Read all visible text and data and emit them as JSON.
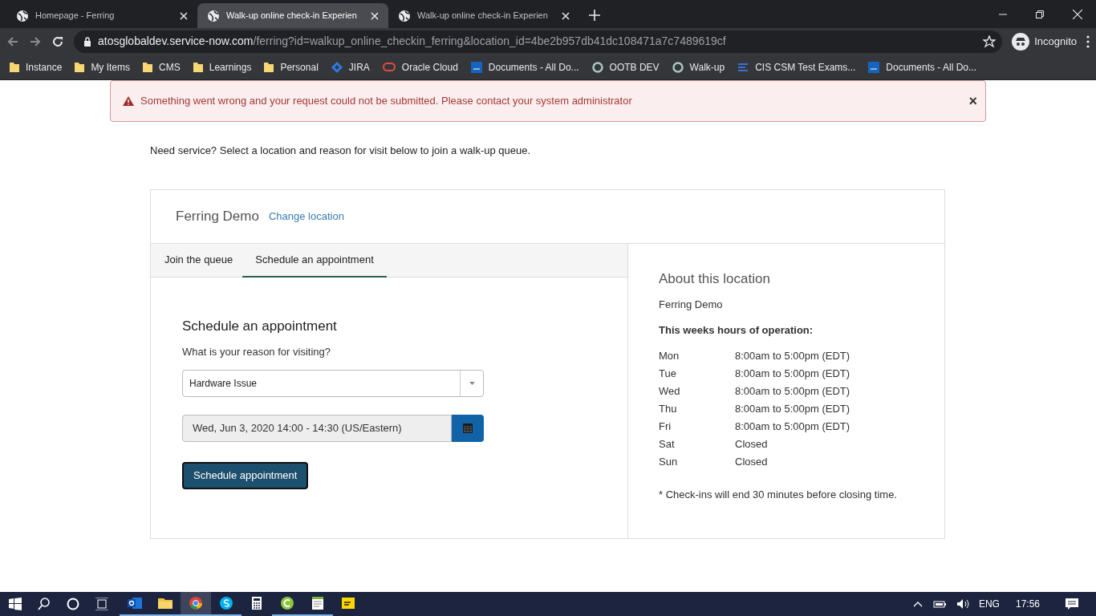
{
  "browser_tabs": [
    {
      "title": "Homepage - Ferring",
      "selected": false
    },
    {
      "title": "Walk-up online check-in Experien",
      "selected": true
    },
    {
      "title": "Walk-up online check-in Experien",
      "selected": false
    }
  ],
  "address_bar": {
    "host": "atosglobaldev.service-now.com",
    "path": "/ferring?id=walkup_online_checkin_ferring&location_id=4be2b957db41dc108471a7c7489619cf",
    "profile": "Incognito"
  },
  "bookmarks": [
    {
      "kind": "folder",
      "label": "Instance"
    },
    {
      "kind": "folder",
      "label": "My Items"
    },
    {
      "kind": "folder",
      "label": "CMS"
    },
    {
      "kind": "folder",
      "label": "Learnings"
    },
    {
      "kind": "folder",
      "label": "Personal"
    },
    {
      "kind": "diamond",
      "label": "JIRA"
    },
    {
      "kind": "oracle",
      "label": "Oracle Cloud"
    },
    {
      "kind": "atos",
      "label": "Documents - All Do..."
    },
    {
      "kind": "ring",
      "label": "OOTB DEV"
    },
    {
      "kind": "ring",
      "label": "Walk-up"
    },
    {
      "kind": "bars",
      "label": "CIS CSM Test Exams..."
    },
    {
      "kind": "atos",
      "label": "Documents - All Do..."
    }
  ],
  "alert": {
    "message": "Something went wrong and your request could not be submitted. Please contact your system administrator",
    "close": "×"
  },
  "subtitle": "Need service? Select a location and reason for visit below to join a walk-up queue.",
  "location": {
    "name": "Ferring Demo",
    "change_link": "Change location"
  },
  "tabs": [
    {
      "label": "Join the queue",
      "selected": false
    },
    {
      "label": "Schedule an appointment",
      "selected": true
    }
  ],
  "form": {
    "title": "Schedule an appointment",
    "question": "What is your reason for visiting?",
    "reason": "Hardware Issue",
    "datetime": "Wed, Jun 3, 2020 14:00 - 14:30 (US/Eastern)",
    "submit": "Schedule appointment"
  },
  "about": {
    "title": "About this location",
    "name": "Ferring Demo",
    "hours_title": "This weeks hours of operation:",
    "hours": [
      {
        "day": "Mon",
        "time": "8:00am to 5:00pm (EDT)"
      },
      {
        "day": "Tue",
        "time": "8:00am to 5:00pm (EDT)"
      },
      {
        "day": "Wed",
        "time": "8:00am to 5:00pm (EDT)"
      },
      {
        "day": "Thu",
        "time": "8:00am to 5:00pm (EDT)"
      },
      {
        "day": "Fri",
        "time": "8:00am to 5:00pm (EDT)"
      },
      {
        "day": "Sat",
        "time": "Closed"
      },
      {
        "day": "Sun",
        "time": "Closed"
      }
    ],
    "note": "* Check-ins will end 30 minutes before closing time."
  },
  "taskbar": {
    "apps": [
      {
        "kind": "outlook",
        "running": true,
        "selected": false
      },
      {
        "kind": "explorer",
        "running": true,
        "selected": false
      },
      {
        "kind": "chrome",
        "running": true,
        "selected": true
      },
      {
        "kind": "skype",
        "running": true,
        "selected": false
      },
      {
        "kind": "calculator",
        "running": false,
        "selected": false
      },
      {
        "kind": "green-c",
        "running": true,
        "selected": false
      },
      {
        "kind": "notepad",
        "running": true,
        "selected": false
      },
      {
        "kind": "sticky",
        "running": false,
        "selected": false
      }
    ],
    "language": "ENG",
    "time": "17:56"
  }
}
